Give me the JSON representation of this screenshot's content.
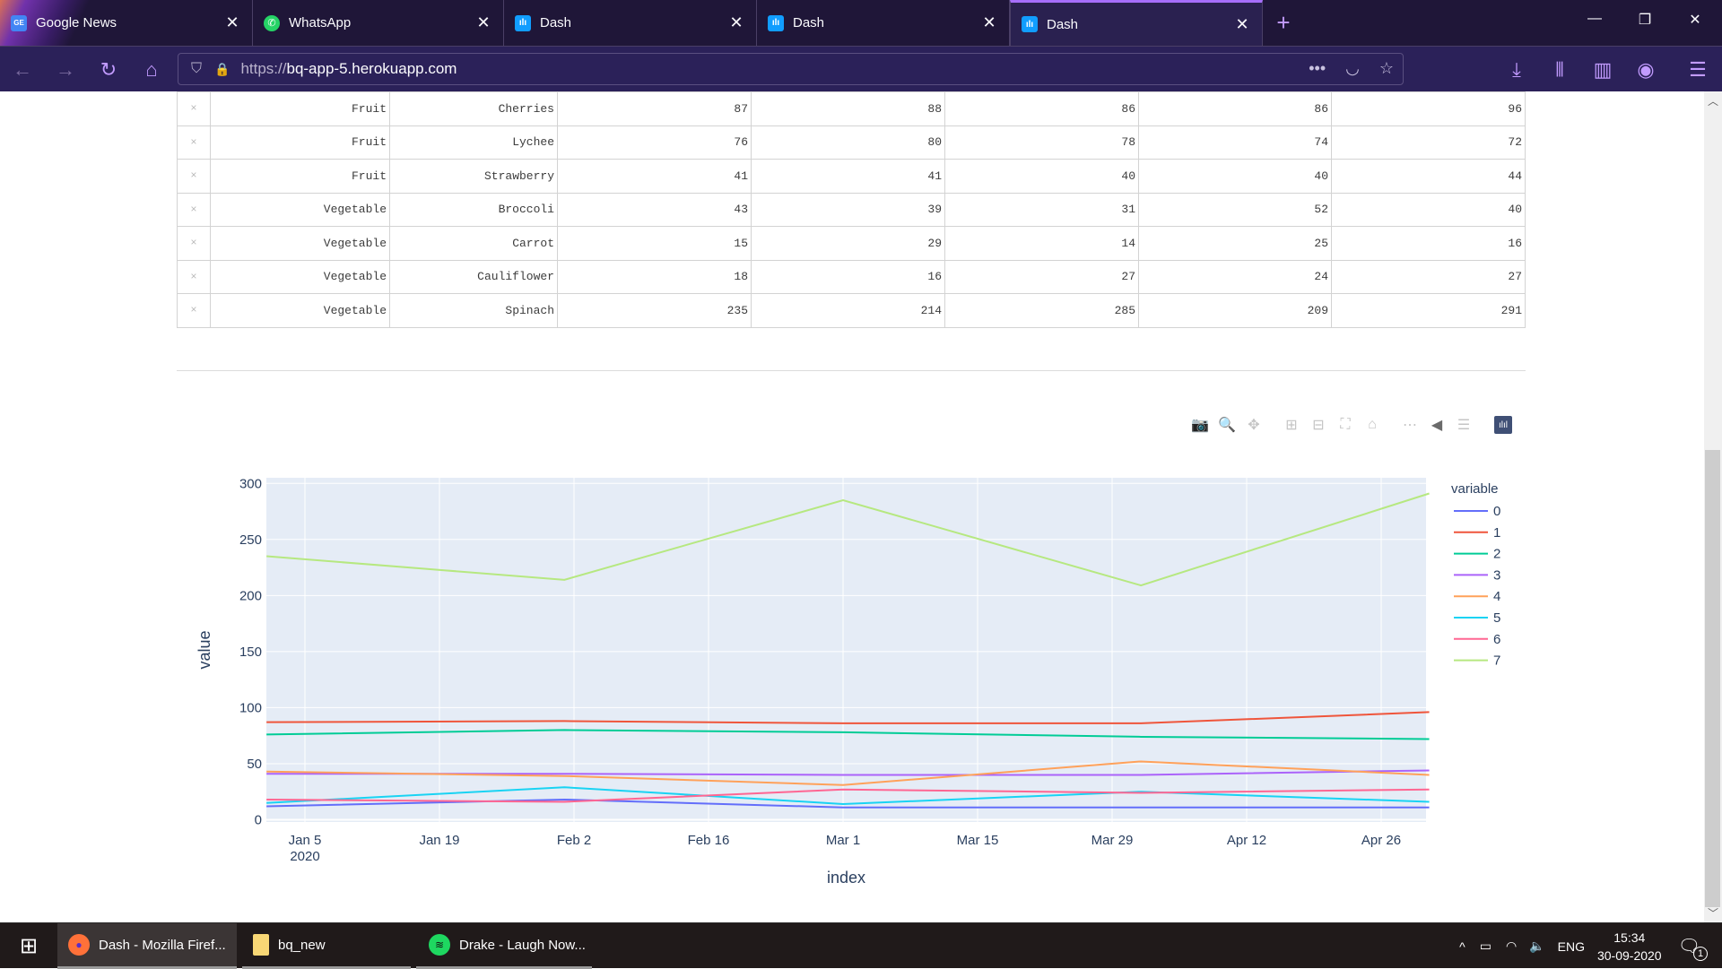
{
  "browser": {
    "tabs": [
      {
        "label": "Google News",
        "icon": "google-news-icon",
        "active": false
      },
      {
        "label": "WhatsApp",
        "icon": "whatsapp-icon",
        "active": false
      },
      {
        "label": "Dash",
        "icon": "dash-icon",
        "active": false
      },
      {
        "label": "Dash",
        "icon": "dash-icon",
        "active": false
      },
      {
        "label": "Dash",
        "icon": "dash-icon",
        "active": true
      }
    ],
    "close_glyph": "✕",
    "new_tab_glyph": "+",
    "window_controls": {
      "minimize": "—",
      "restore": "❐",
      "close": "✕"
    },
    "url_protocol": "https://",
    "url_host": "bq-app-5.herokuapp.com",
    "nav_icons": {
      "back": "←",
      "forward": "→",
      "reload": "↻",
      "home": "⌂",
      "shield": "⛉",
      "lock": "🔒",
      "more": "•••",
      "pocket": "◡",
      "star": "☆",
      "download": "⤓",
      "library": "⫴",
      "sidebar": "▥",
      "account": "◉",
      "menu": "☰"
    }
  },
  "table": {
    "delete_glyph": "×",
    "rows": [
      {
        "category": "Fruit",
        "item": "Cherries",
        "values": [
          "87",
          "88",
          "86",
          "86",
          "96"
        ]
      },
      {
        "category": "Fruit",
        "item": "Lychee",
        "values": [
          "76",
          "80",
          "78",
          "74",
          "72"
        ]
      },
      {
        "category": "Fruit",
        "item": "Strawberry",
        "values": [
          "41",
          "41",
          "40",
          "40",
          "44"
        ]
      },
      {
        "category": "Vegetable",
        "item": "Broccoli",
        "values": [
          "43",
          "39",
          "31",
          "52",
          "40"
        ]
      },
      {
        "category": "Vegetable",
        "item": "Carrot",
        "values": [
          "15",
          "29",
          "14",
          "25",
          "16"
        ]
      },
      {
        "category": "Vegetable",
        "item": "Cauliflower",
        "values": [
          "18",
          "16",
          "27",
          "24",
          "27"
        ]
      },
      {
        "category": "Vegetable",
        "item": "Spinach",
        "values": [
          "235",
          "214",
          "285",
          "209",
          "291"
        ]
      }
    ]
  },
  "modebar": [
    {
      "name": "download-plot-icon",
      "glyph": "📷",
      "active": false
    },
    {
      "name": "zoom-icon",
      "glyph": "🔍",
      "active": true
    },
    {
      "name": "pan-icon",
      "glyph": "✥",
      "active": false
    },
    {
      "name": "zoom-in-icon",
      "glyph": "⊞",
      "active": false
    },
    {
      "name": "zoom-out-icon",
      "glyph": "⊟",
      "active": false
    },
    {
      "name": "autoscale-icon",
      "glyph": "⛶",
      "active": false
    },
    {
      "name": "reset-axes-icon",
      "glyph": "⌂",
      "active": false
    },
    {
      "name": "spike-lines-icon",
      "glyph": "⋯",
      "active": false
    },
    {
      "name": "hover-closest-icon",
      "glyph": "◀",
      "active": true
    },
    {
      "name": "hover-compare-icon",
      "glyph": "☰",
      "active": false
    },
    {
      "name": "plotly-logo-icon",
      "glyph": "ılıl",
      "active": false
    }
  ],
  "chart_data": {
    "type": "line",
    "title": "",
    "xlabel": "index",
    "ylabel": "value",
    "x": [
      "2020-01-01",
      "2020-02-01",
      "2020-03-01",
      "2020-04-01",
      "2020-05-01"
    ],
    "x_ticks": [
      "Jan 5",
      "Jan 19",
      "Feb 2",
      "Feb 16",
      "Mar 1",
      "Mar 15",
      "Mar 29",
      "Apr 12",
      "Apr 26"
    ],
    "x_tick_dates": [
      "2020-01-05",
      "2020-01-19",
      "2020-02-02",
      "2020-02-16",
      "2020-03-01",
      "2020-03-15",
      "2020-03-29",
      "2020-04-12",
      "2020-04-26"
    ],
    "x_year_label": "2020",
    "y_ticks": [
      0,
      50,
      100,
      150,
      200,
      250,
      300
    ],
    "ylim": [
      -2,
      305
    ],
    "grid": true,
    "legend_title": "variable",
    "legend_position": "right",
    "series": [
      {
        "name": "0",
        "color": "#636efa",
        "values": [
          12,
          18,
          11,
          11,
          11
        ]
      },
      {
        "name": "1",
        "color": "#ef553b",
        "values": [
          87,
          88,
          86,
          86,
          96
        ]
      },
      {
        "name": "2",
        "color": "#00cc96",
        "values": [
          76,
          80,
          78,
          74,
          72
        ]
      },
      {
        "name": "3",
        "color": "#ab63fa",
        "values": [
          41,
          41,
          40,
          40,
          44
        ]
      },
      {
        "name": "4",
        "color": "#ffa15a",
        "values": [
          43,
          39,
          31,
          52,
          40
        ]
      },
      {
        "name": "5",
        "color": "#19d3f3",
        "values": [
          15,
          29,
          14,
          25,
          16
        ]
      },
      {
        "name": "6",
        "color": "#ff6692",
        "values": [
          18,
          16,
          27,
          24,
          27
        ]
      },
      {
        "name": "7",
        "color": "#b6e880",
        "values": [
          235,
          214,
          285,
          209,
          291
        ]
      }
    ]
  },
  "taskbar": {
    "start_glyph": "⊞",
    "apps": [
      {
        "label": "Dash - Mozilla Firef...",
        "icon": "firefox-icon",
        "active": true
      },
      {
        "label": "bq_new",
        "icon": "folder-icon",
        "active": false
      },
      {
        "label": "Drake - Laugh Now...",
        "icon": "spotify-icon",
        "active": false
      }
    ],
    "tray": {
      "chevron": "^",
      "battery": "▭",
      "wifi": "◠",
      "volume": "🔈",
      "language": "ENG",
      "time": "15:34",
      "date": "30-09-2020",
      "notifications": "1"
    }
  }
}
